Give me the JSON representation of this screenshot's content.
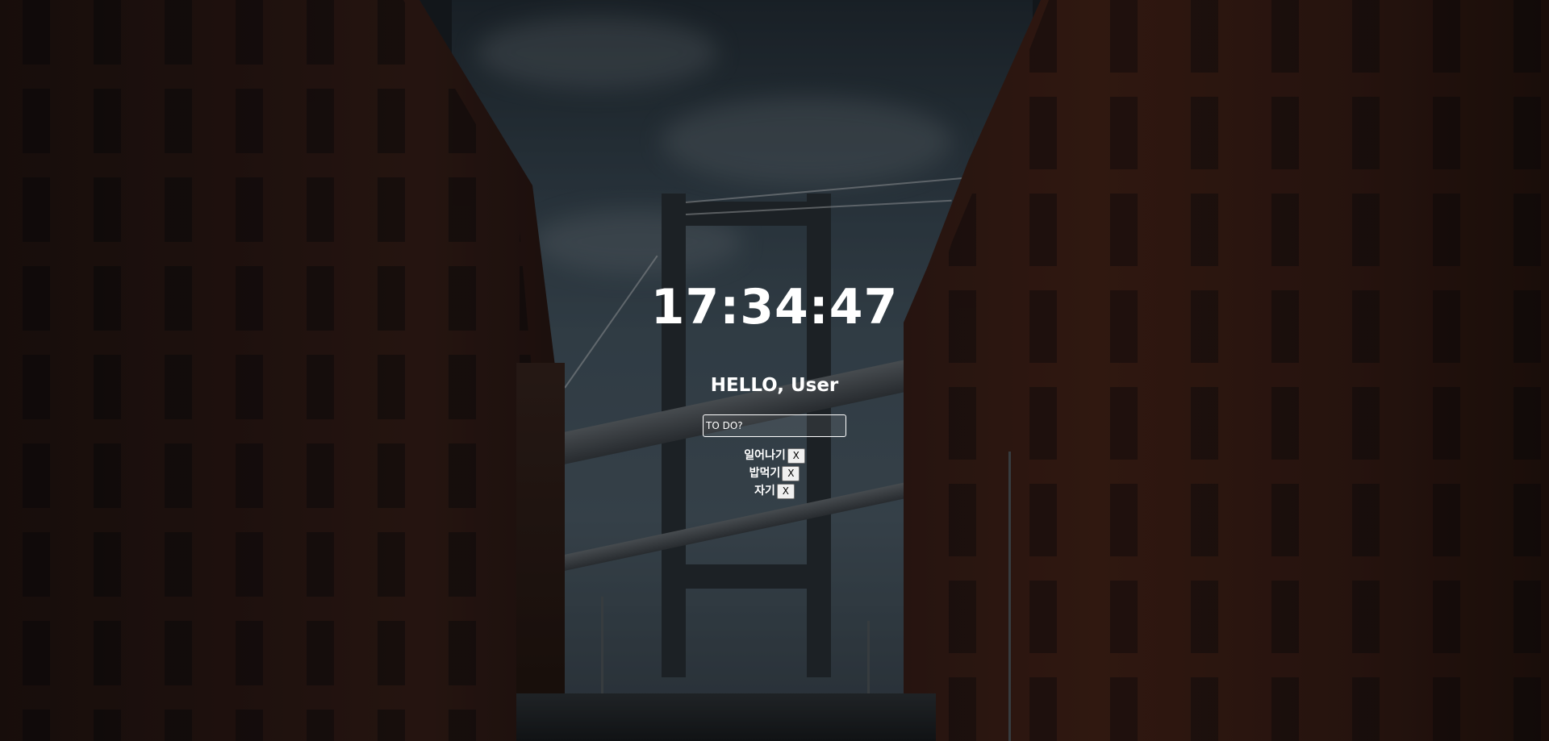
{
  "clock": {
    "time": "17:34:47"
  },
  "greeting": {
    "text": "HELLO, User"
  },
  "todo_form": {
    "placeholder": "TO DO?"
  },
  "todos": [
    {
      "text": "일어나기",
      "delete_label": "X"
    },
    {
      "text": "밥먹기",
      "delete_label": "X"
    },
    {
      "text": "자기",
      "delete_label": "X"
    }
  ]
}
